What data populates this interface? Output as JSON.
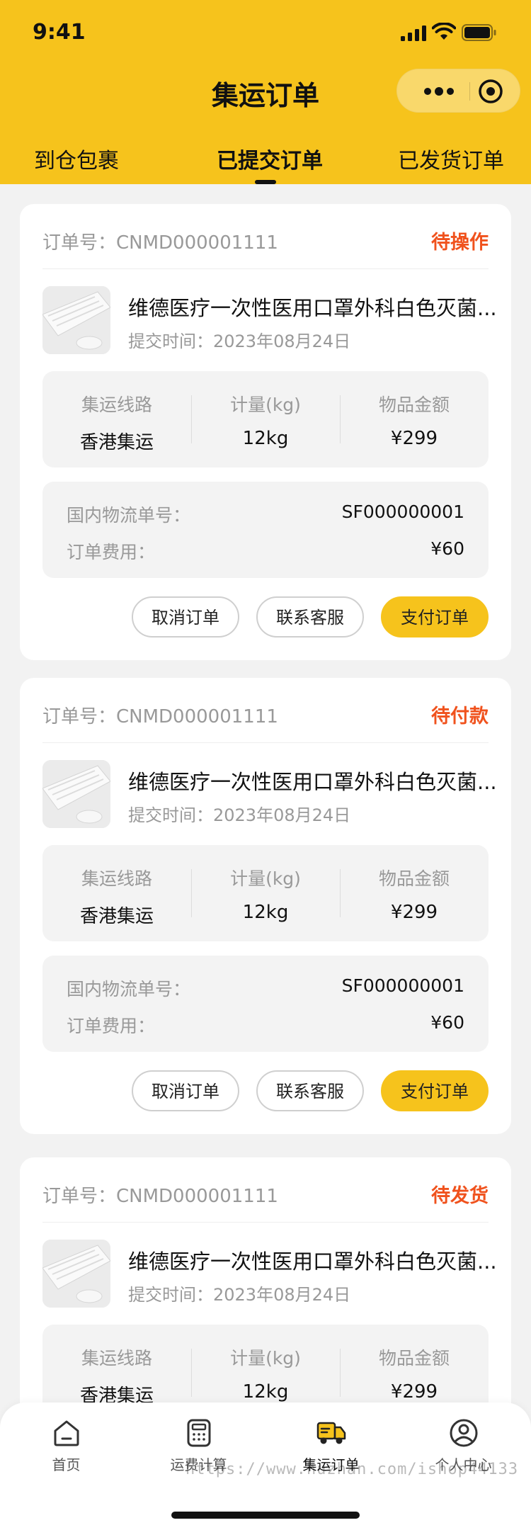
{
  "status_bar": {
    "time": "9:41"
  },
  "header": {
    "title": "集运订单"
  },
  "tabs": [
    {
      "label": "到仓包裹"
    },
    {
      "label": "已提交订单"
    },
    {
      "label": "已发货订单"
    }
  ],
  "colors": {
    "accent": "#f6c31c",
    "status": "#f0521d"
  },
  "orders": [
    {
      "order_no": "订单号：CNMD000001111",
      "status": "待操作",
      "product_name": "维德医疗一次性医用口罩外科白色灭菌...",
      "submit_time": "提交时间：2023年08月24日",
      "route_label": "集运线路",
      "route_value": "香港集运",
      "weight_label": "计量(kg)",
      "weight_value": "12kg",
      "amount_label": "物品金额",
      "amount_value": "¥299",
      "tracking_label": "国内物流单号：",
      "tracking_value": "SF000000001",
      "fee_label": "订单费用：",
      "fee_value": "¥60",
      "btn_cancel": "取消订单",
      "btn_service": "联系客服",
      "btn_pay": "支付订单"
    },
    {
      "order_no": "订单号：CNMD000001111",
      "status": "待付款",
      "product_name": "维德医疗一次性医用口罩外科白色灭菌...",
      "submit_time": "提交时间：2023年08月24日",
      "route_label": "集运线路",
      "route_value": "香港集运",
      "weight_label": "计量(kg)",
      "weight_value": "12kg",
      "amount_label": "物品金额",
      "amount_value": "¥299",
      "tracking_label": "国内物流单号：",
      "tracking_value": "SF000000001",
      "fee_label": "订单费用：",
      "fee_value": "¥60",
      "btn_cancel": "取消订单",
      "btn_service": "联系客服",
      "btn_pay": "支付订单"
    },
    {
      "order_no": "订单号：CNMD000001111",
      "status": "待发货",
      "product_name": "维德医疗一次性医用口罩外科白色灭菌...",
      "submit_time": "提交时间：2023年08月24日",
      "route_label": "集运线路",
      "route_value": "香港集运",
      "weight_label": "计量(kg)",
      "weight_value": "12kg",
      "amount_label": "物品金额",
      "amount_value": "¥299"
    }
  ],
  "tabbar": [
    {
      "label": "首页",
      "icon": "home-icon"
    },
    {
      "label": "运费计算",
      "icon": "calculator-icon"
    },
    {
      "label": "集运订单",
      "icon": "truck-icon"
    },
    {
      "label": "个人中心",
      "icon": "user-icon"
    }
  ],
  "watermark": "https://www.huzhan.com/ishop44133"
}
